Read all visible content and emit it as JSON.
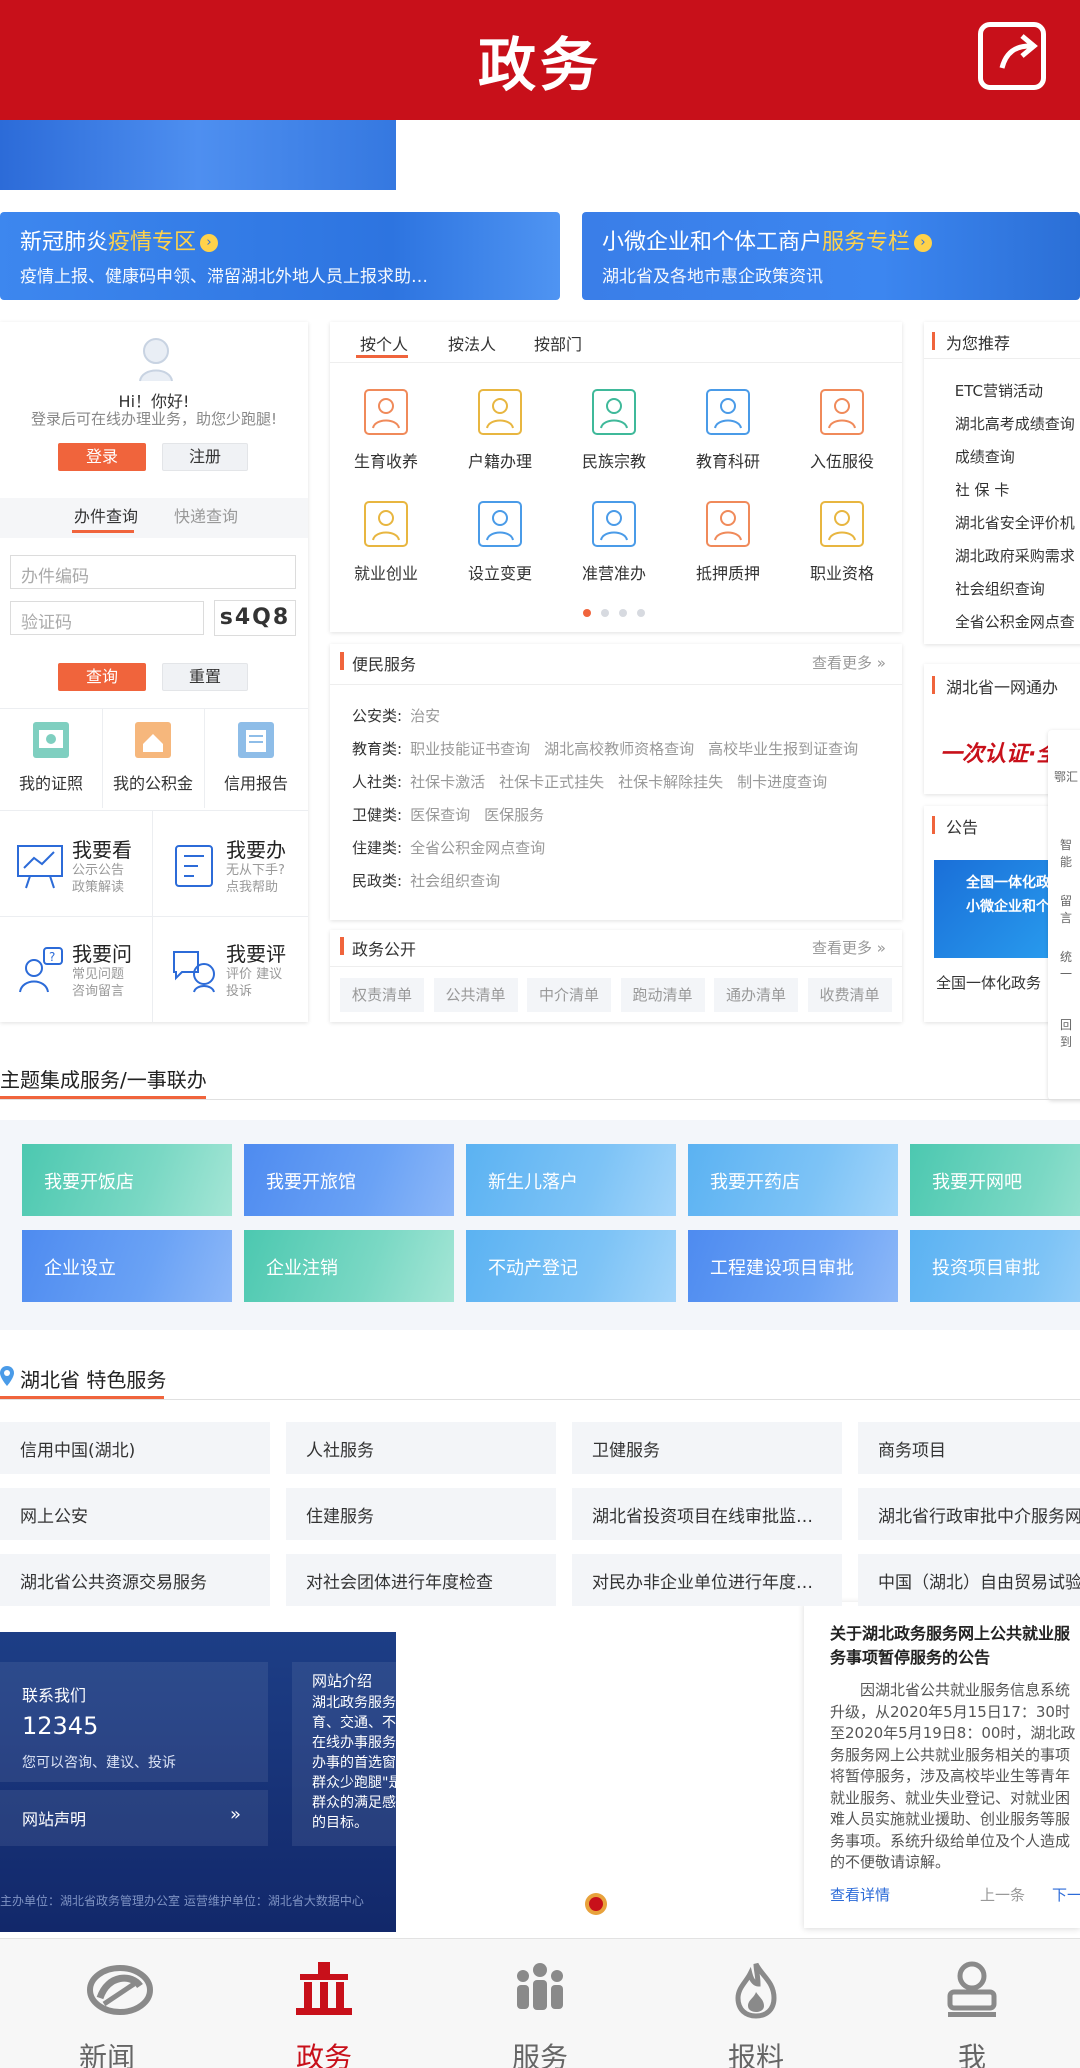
{
  "colors": {
    "brand_red": "#c8101a",
    "accent_orange": "#f0643c",
    "link_blue": "#2c6bd8"
  },
  "header": {
    "title": "政务",
    "share_icon": "share-icon"
  },
  "banners": [
    {
      "title_prefix": "新冠肺炎",
      "title_highlight": "疫情专区",
      "subtitle": "疫情上报、健康码申领、滞留湖北外地人员上报求助…"
    },
    {
      "title_prefix": "小微企业和个体工商户",
      "title_highlight": "服务专栏",
      "subtitle": "湖北省及各地市惠企政策资讯"
    }
  ],
  "login_card": {
    "greeting": "Hi！你好!",
    "tip": "登录后可在线办理业务，助您少跑腿!",
    "login_label": "登录",
    "register_label": "注册",
    "tabs": [
      "办件查询",
      "快递查询"
    ],
    "case_no_placeholder": "办件编码",
    "captcha_placeholder": "验证码",
    "captcha_text": "s4Q8",
    "query_label": "查询",
    "reset_label": "重置",
    "quick": [
      "我的证照",
      "我的公积金",
      "信用报告"
    ],
    "features": [
      {
        "title": "我要看",
        "sub1": "公示公告",
        "sub2": "政策解读"
      },
      {
        "title": "我要办",
        "sub1": "无从下手?",
        "sub2": "点我帮助"
      },
      {
        "title": "我要问",
        "sub1": "常见问题",
        "sub2": "咨询留言"
      },
      {
        "title": "我要评",
        "sub1": "评价 建议",
        "sub2": "投诉"
      }
    ]
  },
  "services": {
    "tabs": [
      "按个人",
      "按法人",
      "按部门"
    ],
    "items": [
      "生育收养",
      "户籍办理",
      "民族宗教",
      "教育科研",
      "入伍服役",
      "就业创业",
      "设立变更",
      "准营准办",
      "抵押质押",
      "职业资格"
    ]
  },
  "bianmin": {
    "title": "便民服务",
    "more": "查看更多",
    "rows": [
      {
        "cat": "公安类:",
        "links": [
          "治安"
        ]
      },
      {
        "cat": "教育类:",
        "links": [
          "职业技能证书查询",
          "湖北高校教师资格查询",
          "高校毕业生报到证查询"
        ]
      },
      {
        "cat": "人社类:",
        "links": [
          "社保卡激活",
          "社保卡正式挂失",
          "社保卡解除挂失",
          "制卡进度查询"
        ]
      },
      {
        "cat": "卫健类:",
        "links": [
          "医保查询",
          "医保服务"
        ]
      },
      {
        "cat": "住建类:",
        "links": [
          "全省公积金网点查询"
        ]
      },
      {
        "cat": "民政类:",
        "links": [
          "社会组织查询"
        ]
      }
    ]
  },
  "zwgk": {
    "title": "政务公开",
    "more": "查看更多",
    "chips": [
      "权责清单",
      "公共清单",
      "中介清单",
      "跑动清单",
      "通办清单",
      "收费清单"
    ]
  },
  "recommend": {
    "title": "为您推荐",
    "items": [
      "ETC营销活动",
      "湖北高考成绩查询",
      "成绩查询",
      "社 保 卡",
      "湖北省安全评价机",
      "湖北政府采购需求",
      "社会组织查询",
      "全省公积金网点查"
    ]
  },
  "yiwangtong": {
    "title": "湖北省一网通办",
    "image_text": "一次认证·全"
  },
  "gonggao": {
    "title": "公告",
    "image_line1": "全国一体化政务",
    "image_line2": "小微企业和个体工",
    "caption": "全国一体化政务"
  },
  "side_float": [
    "鄂汇",
    "智能",
    "留言",
    "统一",
    "回到"
  ],
  "theme": {
    "title": "主题集成服务/一事联办",
    "tiles_row1": [
      "我要开饭店",
      "我要开旅馆",
      "新生儿落户",
      "我要开药店",
      "我要开网吧"
    ],
    "tiles_row2": [
      "企业设立",
      "企业注销",
      "不动产登记",
      "工程建设项目审批",
      "投资项目审批"
    ]
  },
  "special": {
    "region": "湖北省",
    "title": "特色服务",
    "rows": [
      [
        "信用中国(湖北)",
        "人社服务",
        "卫健服务",
        "商务项目"
      ],
      [
        "网上公安",
        "住建服务",
        "湖北省投资项目在线审批监…",
        "湖北省行政审批中介服务网"
      ],
      [
        "湖北省公共资源交易服务",
        "对社会团体进行年度检查",
        "对民办非企业单位进行年度…",
        "中国（湖北）自由贸易试验"
      ]
    ]
  },
  "footer": {
    "contact_title": "联系我们",
    "phone": "12345",
    "contact_tip": "您可以咨询、建议、投诉",
    "statement": "网站声明",
    "intro_title": "网站介绍",
    "intro_lines": [
      "湖北政务服务网",
      "育、交通、不动",
      "在线办事服务平",
      "办事的首选窗口",
      "群众少跑腿\"是",
      "群众的满足感和",
      "的目标。"
    ],
    "bottom": "主办单位：湖北省政务管理办公室 运营维护单位：湖北省大数据中心"
  },
  "notice": {
    "title": "关于湖北政务服务网上公共就业服务事项暂停服务的公告",
    "body": "因湖北省公共就业服务信息系统升级，从2020年5月15日17：30时至2020年5月19日8：00时，湖北政务服务网上公共就业服务相关的事项将暂停服务，涉及高校毕业生等青年就业服务、就业失业登记、对就业困难人员实施就业援助、创业服务等服务事项。系统升级给单位及个人造成的不便敬请谅解。",
    "detail": "查看详情",
    "prev": "上一条",
    "next": "下一"
  },
  "bottom_nav": [
    {
      "label": "新闻",
      "icon": "news-icon",
      "active": false
    },
    {
      "label": "政务",
      "icon": "government-building-icon",
      "active": true
    },
    {
      "label": "服务",
      "icon": "people-icon",
      "active": false
    },
    {
      "label": "报料",
      "icon": "fire-icon",
      "active": false
    },
    {
      "label": "我",
      "icon": "person-icon",
      "active": false
    }
  ]
}
